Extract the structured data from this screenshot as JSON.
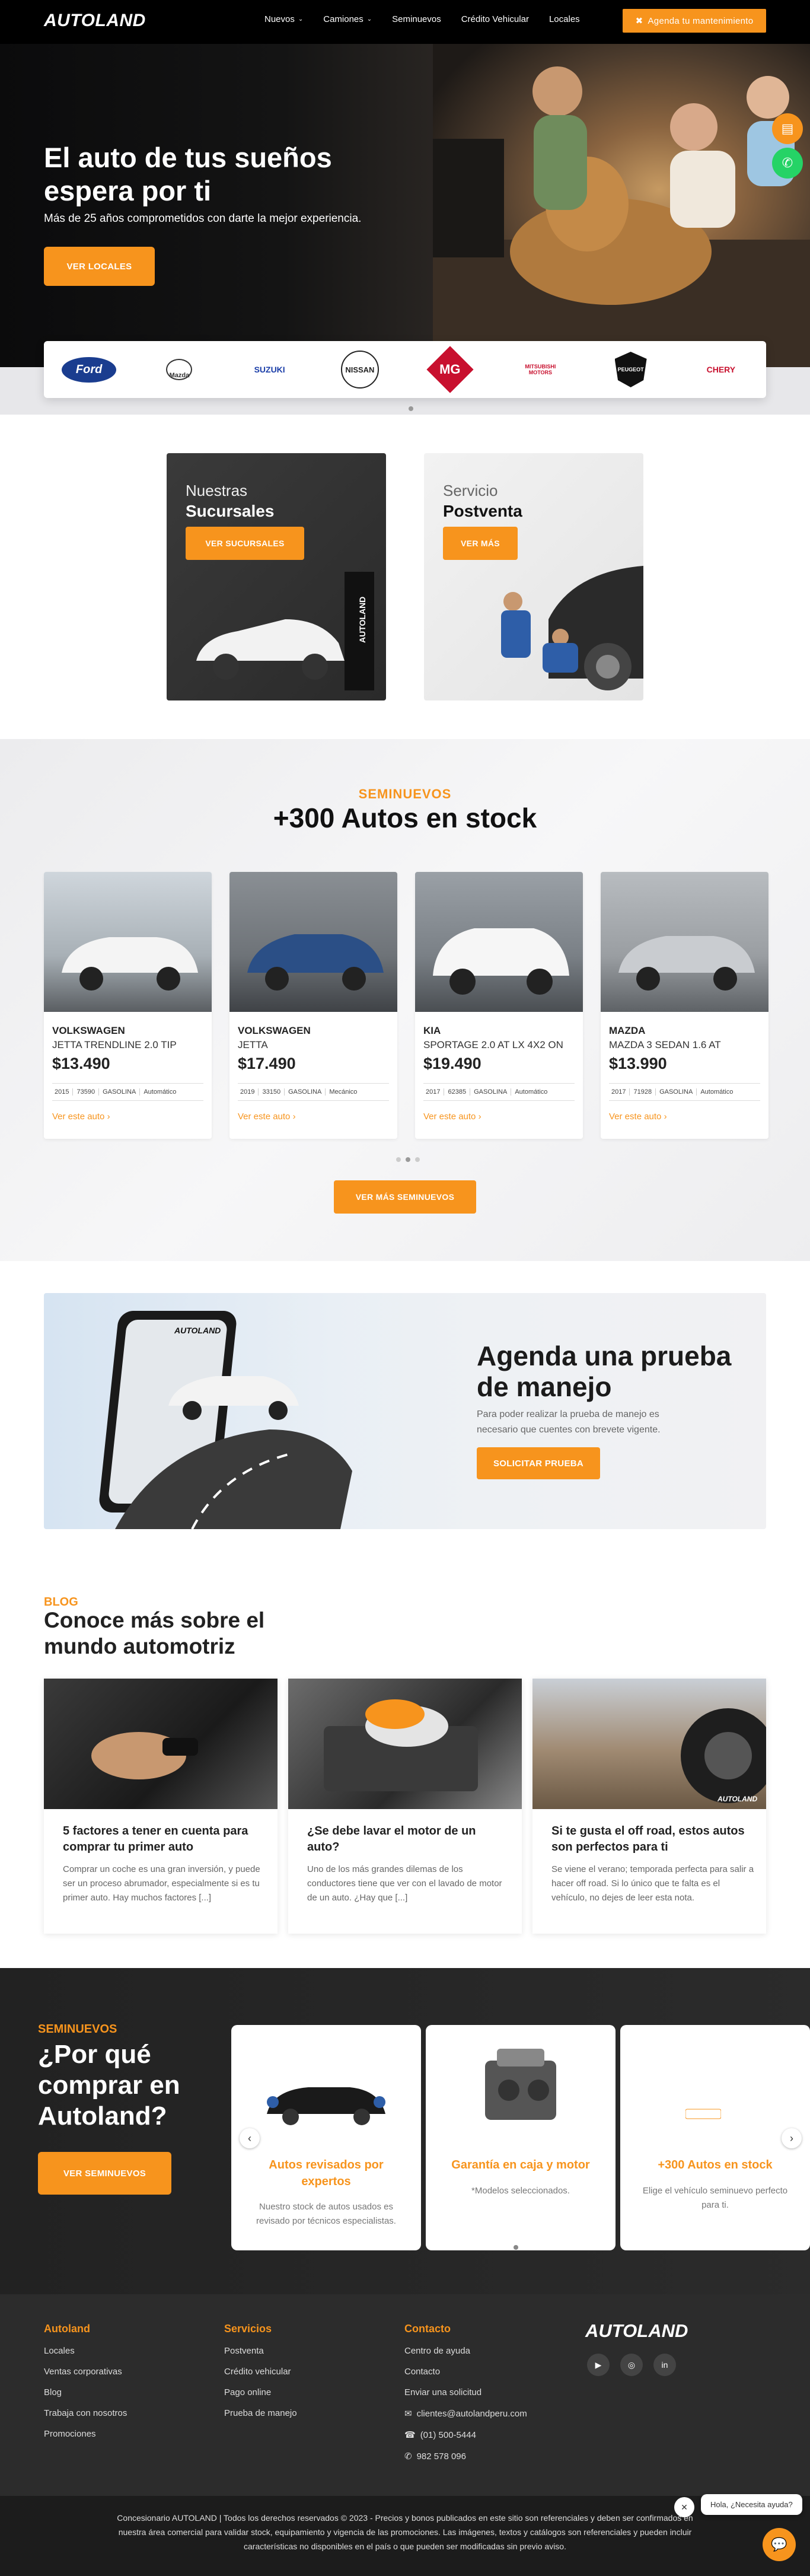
{
  "header": {
    "logo": "AUTOLAND",
    "nav": [
      {
        "label": "Nuevos",
        "has_dropdown": true
      },
      {
        "label": "Camiones",
        "has_dropdown": true
      },
      {
        "label": "Seminuevos",
        "has_dropdown": false
      },
      {
        "label": "Crédito Vehicular",
        "has_dropdown": false
      },
      {
        "label": "Locales",
        "has_dropdown": false
      }
    ],
    "cta": "Agenda tu mantenimiento"
  },
  "hero": {
    "title": "El auto de tus sueños espera por ti",
    "subtitle": "Más de 25 años comprometidos con darte la mejor experiencia.",
    "button": "VER LOCALES"
  },
  "brands": [
    "Ford",
    "Mazda",
    "SUZUKI",
    "NISSAN",
    "MG",
    "MITSUBISHI MOTORS",
    "PEUGEOT",
    "CHERY"
  ],
  "services": [
    {
      "small": "Nuestras",
      "big": "Sucursales",
      "button": "VER SUCURSALES"
    },
    {
      "small": "Servicio",
      "big": "Postventa",
      "button": "VER MÁS"
    }
  ],
  "stock": {
    "kicker": "SEMINUEVOS",
    "title": "+300 Autos en stock",
    "link_label": "Ver este auto",
    "button": "VER MÁS SEMINUEVOS",
    "cars": [
      {
        "brand": "VOLKSWAGEN",
        "model": "JETTA TRENDLINE 2.0 TIP",
        "price": "$13.490",
        "specs": [
          "2015",
          "73590",
          "GASOLINA",
          "Automático"
        ]
      },
      {
        "brand": "VOLKSWAGEN",
        "model": "JETTA",
        "price": "$17.490",
        "specs": [
          "2019",
          "33150",
          "GASOLINA",
          "Mecánico"
        ]
      },
      {
        "brand": "KIA",
        "model": "SPORTAGE 2.0 AT LX 4X2 ON",
        "price": "$19.490",
        "specs": [
          "2017",
          "62385",
          "GASOLINA",
          "Automático"
        ]
      },
      {
        "brand": "MAZDA",
        "model": "MAZDA 3 SEDAN 1.6 AT",
        "price": "$13.990",
        "specs": [
          "2017",
          "71928",
          "GASOLINA",
          "Automático"
        ]
      }
    ]
  },
  "testdrive": {
    "title": "Agenda una prueba de manejo",
    "subtitle": "Para poder realizar la prueba de manejo es necesario que cuentes con brevete vigente.",
    "button": "SOLICITAR PRUEBA",
    "phone_logo": "AUTOLAND"
  },
  "blog": {
    "kicker": "BLOG",
    "title": "Conoce más sobre el mundo automotriz",
    "posts": [
      {
        "title": "5 factores a tener en cuenta para comprar tu primer auto",
        "excerpt": "Comprar un coche es una gran inversión, y puede ser un proceso abrumador, especialmente si es tu primer auto. Hay muchos factores [...]"
      },
      {
        "title": "¿Se debe lavar el motor de un auto?",
        "excerpt": "Uno de los más grandes dilemas de los conductores tiene que ver con el lavado de motor de un auto. ¿Hay que [...]"
      },
      {
        "title": "Si te gusta el off road, estos autos son perfectos para ti",
        "excerpt": "Se viene el verano; temporada perfecta para salir a hacer off road. Si lo único que te falta es el vehículo, no dejes de leer esta nota."
      }
    ],
    "photo_logo": "AUTOLAND"
  },
  "why": {
    "kicker": "SEMINUEVOS",
    "title": "¿Por qué comprar en Autoland?",
    "button": "VER SEMINUEVOS",
    "cards": [
      {
        "title": "Autos revisados por expertos",
        "text": "Nuestro stock de autos usados es revisado por técnicos especialistas."
      },
      {
        "title": "Garantía en caja y motor",
        "text": "*Modelos seleccionados."
      },
      {
        "title": "+300 Autos en stock",
        "text": "Elige el vehículo seminuevo perfecto para ti."
      }
    ]
  },
  "footer": {
    "cols": [
      {
        "title": "Autoland",
        "links": [
          "Locales",
          "Ventas corporativas",
          "Blog",
          "Trabaja con nosotros",
          "Promociones"
        ]
      },
      {
        "title": "Servicios",
        "links": [
          "Postventa",
          "Crédito vehicular",
          "Pago online",
          "Prueba de manejo"
        ]
      },
      {
        "title": "Contacto",
        "links": [
          "Centro de ayuda",
          "Contacto",
          "Enviar una solicitud",
          "clientes@autolandperu.com",
          "(01) 500-5444",
          "982 578 096"
        ]
      }
    ],
    "logo": "AUTOLAND",
    "legal": "Concesionario AUTOLAND | Todos los derechos reservados © 2023 - Precios y bonos publicados en este sitio son referenciales y deben ser confirmados en nuestra área comercial para validar stock, equipamiento y vigencia de las promociones. Las imágenes, textos y catálogos son referenciales y pueden incluir características no disponibles en el país o que pueden ser modificadas sin previo aviso."
  },
  "chat": {
    "bubble": "Hola, ¿Necesita ayuda?"
  },
  "colors": {
    "accent": "#f7941d",
    "dark": "#2c2c2c"
  }
}
